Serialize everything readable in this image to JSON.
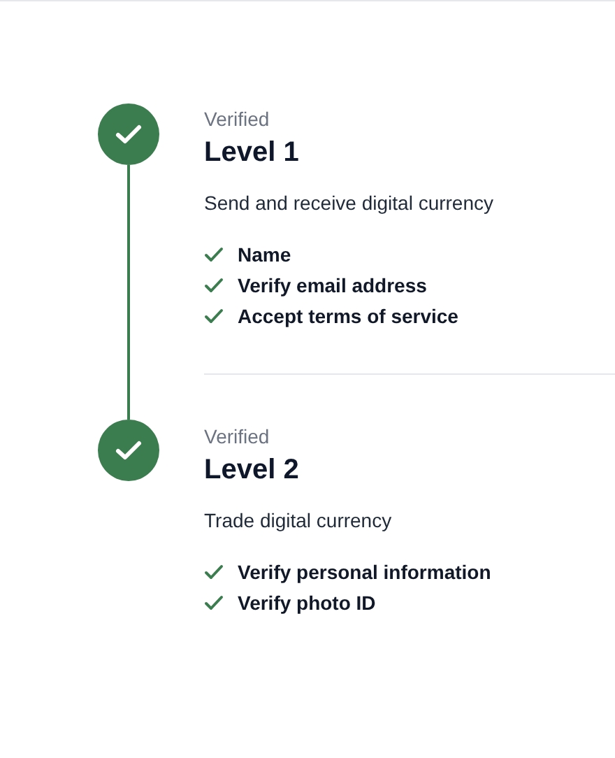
{
  "levels": [
    {
      "status": "Verified",
      "completed": true,
      "title": "Level 1",
      "description": "Send and receive digital currency",
      "requirements": [
        {
          "label": "Name",
          "done": true
        },
        {
          "label": "Verify email address",
          "done": true
        },
        {
          "label": "Accept terms of service",
          "done": true
        }
      ]
    },
    {
      "status": "Verified",
      "completed": true,
      "title": "Level 2",
      "description": "Trade digital currency",
      "requirements": [
        {
          "label": "Verify personal information",
          "done": true
        },
        {
          "label": "Verify photo ID",
          "done": true
        }
      ]
    }
  ]
}
